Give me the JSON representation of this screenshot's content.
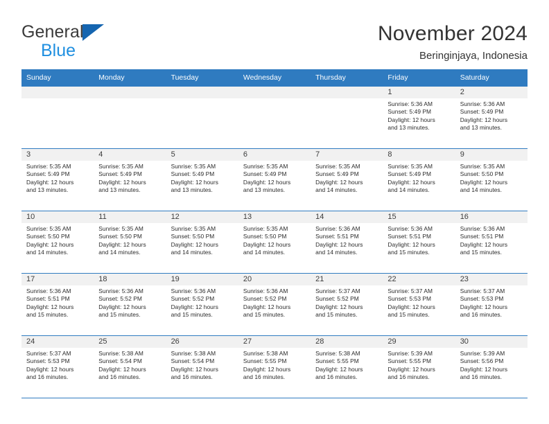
{
  "brand": {
    "name_part1": "General",
    "name_part2": "Blue",
    "triangle_color": "#1565b0",
    "blue_text_color": "#1f8fe0"
  },
  "header": {
    "title": "November 2024",
    "subtitle": "Beringinjaya, Indonesia"
  },
  "theme": {
    "header_row_bg": "#2f7bc0",
    "header_row_text": "#ffffff",
    "date_band_bg": "#f1f1f1",
    "row_divider": "#2f7bc0"
  },
  "weekdays": [
    "Sunday",
    "Monday",
    "Tuesday",
    "Wednesday",
    "Thursday",
    "Friday",
    "Saturday"
  ],
  "weeks": [
    [
      {
        "date": "",
        "empty": true
      },
      {
        "date": "",
        "empty": true
      },
      {
        "date": "",
        "empty": true
      },
      {
        "date": "",
        "empty": true
      },
      {
        "date": "",
        "empty": true
      },
      {
        "date": "1",
        "sunrise": "Sunrise: 5:36 AM",
        "sunset": "Sunset: 5:49 PM",
        "daylight_line1": "Daylight: 12 hours",
        "daylight_line2": "and 13 minutes."
      },
      {
        "date": "2",
        "sunrise": "Sunrise: 5:36 AM",
        "sunset": "Sunset: 5:49 PM",
        "daylight_line1": "Daylight: 12 hours",
        "daylight_line2": "and 13 minutes."
      }
    ],
    [
      {
        "date": "3",
        "sunrise": "Sunrise: 5:35 AM",
        "sunset": "Sunset: 5:49 PM",
        "daylight_line1": "Daylight: 12 hours",
        "daylight_line2": "and 13 minutes."
      },
      {
        "date": "4",
        "sunrise": "Sunrise: 5:35 AM",
        "sunset": "Sunset: 5:49 PM",
        "daylight_line1": "Daylight: 12 hours",
        "daylight_line2": "and 13 minutes."
      },
      {
        "date": "5",
        "sunrise": "Sunrise: 5:35 AM",
        "sunset": "Sunset: 5:49 PM",
        "daylight_line1": "Daylight: 12 hours",
        "daylight_line2": "and 13 minutes."
      },
      {
        "date": "6",
        "sunrise": "Sunrise: 5:35 AM",
        "sunset": "Sunset: 5:49 PM",
        "daylight_line1": "Daylight: 12 hours",
        "daylight_line2": "and 13 minutes."
      },
      {
        "date": "7",
        "sunrise": "Sunrise: 5:35 AM",
        "sunset": "Sunset: 5:49 PM",
        "daylight_line1": "Daylight: 12 hours",
        "daylight_line2": "and 14 minutes."
      },
      {
        "date": "8",
        "sunrise": "Sunrise: 5:35 AM",
        "sunset": "Sunset: 5:49 PM",
        "daylight_line1": "Daylight: 12 hours",
        "daylight_line2": "and 14 minutes."
      },
      {
        "date": "9",
        "sunrise": "Sunrise: 5:35 AM",
        "sunset": "Sunset: 5:50 PM",
        "daylight_line1": "Daylight: 12 hours",
        "daylight_line2": "and 14 minutes."
      }
    ],
    [
      {
        "date": "10",
        "sunrise": "Sunrise: 5:35 AM",
        "sunset": "Sunset: 5:50 PM",
        "daylight_line1": "Daylight: 12 hours",
        "daylight_line2": "and 14 minutes."
      },
      {
        "date": "11",
        "sunrise": "Sunrise: 5:35 AM",
        "sunset": "Sunset: 5:50 PM",
        "daylight_line1": "Daylight: 12 hours",
        "daylight_line2": "and 14 minutes."
      },
      {
        "date": "12",
        "sunrise": "Sunrise: 5:35 AM",
        "sunset": "Sunset: 5:50 PM",
        "daylight_line1": "Daylight: 12 hours",
        "daylight_line2": "and 14 minutes."
      },
      {
        "date": "13",
        "sunrise": "Sunrise: 5:35 AM",
        "sunset": "Sunset: 5:50 PM",
        "daylight_line1": "Daylight: 12 hours",
        "daylight_line2": "and 14 minutes."
      },
      {
        "date": "14",
        "sunrise": "Sunrise: 5:36 AM",
        "sunset": "Sunset: 5:51 PM",
        "daylight_line1": "Daylight: 12 hours",
        "daylight_line2": "and 14 minutes."
      },
      {
        "date": "15",
        "sunrise": "Sunrise: 5:36 AM",
        "sunset": "Sunset: 5:51 PM",
        "daylight_line1": "Daylight: 12 hours",
        "daylight_line2": "and 15 minutes."
      },
      {
        "date": "16",
        "sunrise": "Sunrise: 5:36 AM",
        "sunset": "Sunset: 5:51 PM",
        "daylight_line1": "Daylight: 12 hours",
        "daylight_line2": "and 15 minutes."
      }
    ],
    [
      {
        "date": "17",
        "sunrise": "Sunrise: 5:36 AM",
        "sunset": "Sunset: 5:51 PM",
        "daylight_line1": "Daylight: 12 hours",
        "daylight_line2": "and 15 minutes."
      },
      {
        "date": "18",
        "sunrise": "Sunrise: 5:36 AM",
        "sunset": "Sunset: 5:52 PM",
        "daylight_line1": "Daylight: 12 hours",
        "daylight_line2": "and 15 minutes."
      },
      {
        "date": "19",
        "sunrise": "Sunrise: 5:36 AM",
        "sunset": "Sunset: 5:52 PM",
        "daylight_line1": "Daylight: 12 hours",
        "daylight_line2": "and 15 minutes."
      },
      {
        "date": "20",
        "sunrise": "Sunrise: 5:36 AM",
        "sunset": "Sunset: 5:52 PM",
        "daylight_line1": "Daylight: 12 hours",
        "daylight_line2": "and 15 minutes."
      },
      {
        "date": "21",
        "sunrise": "Sunrise: 5:37 AM",
        "sunset": "Sunset: 5:52 PM",
        "daylight_line1": "Daylight: 12 hours",
        "daylight_line2": "and 15 minutes."
      },
      {
        "date": "22",
        "sunrise": "Sunrise: 5:37 AM",
        "sunset": "Sunset: 5:53 PM",
        "daylight_line1": "Daylight: 12 hours",
        "daylight_line2": "and 15 minutes."
      },
      {
        "date": "23",
        "sunrise": "Sunrise: 5:37 AM",
        "sunset": "Sunset: 5:53 PM",
        "daylight_line1": "Daylight: 12 hours",
        "daylight_line2": "and 16 minutes."
      }
    ],
    [
      {
        "date": "24",
        "sunrise": "Sunrise: 5:37 AM",
        "sunset": "Sunset: 5:53 PM",
        "daylight_line1": "Daylight: 12 hours",
        "daylight_line2": "and 16 minutes."
      },
      {
        "date": "25",
        "sunrise": "Sunrise: 5:38 AM",
        "sunset": "Sunset: 5:54 PM",
        "daylight_line1": "Daylight: 12 hours",
        "daylight_line2": "and 16 minutes."
      },
      {
        "date": "26",
        "sunrise": "Sunrise: 5:38 AM",
        "sunset": "Sunset: 5:54 PM",
        "daylight_line1": "Daylight: 12 hours",
        "daylight_line2": "and 16 minutes."
      },
      {
        "date": "27",
        "sunrise": "Sunrise: 5:38 AM",
        "sunset": "Sunset: 5:55 PM",
        "daylight_line1": "Daylight: 12 hours",
        "daylight_line2": "and 16 minutes."
      },
      {
        "date": "28",
        "sunrise": "Sunrise: 5:38 AM",
        "sunset": "Sunset: 5:55 PM",
        "daylight_line1": "Daylight: 12 hours",
        "daylight_line2": "and 16 minutes."
      },
      {
        "date": "29",
        "sunrise": "Sunrise: 5:39 AM",
        "sunset": "Sunset: 5:55 PM",
        "daylight_line1": "Daylight: 12 hours",
        "daylight_line2": "and 16 minutes."
      },
      {
        "date": "30",
        "sunrise": "Sunrise: 5:39 AM",
        "sunset": "Sunset: 5:56 PM",
        "daylight_line1": "Daylight: 12 hours",
        "daylight_line2": "and 16 minutes."
      }
    ]
  ]
}
